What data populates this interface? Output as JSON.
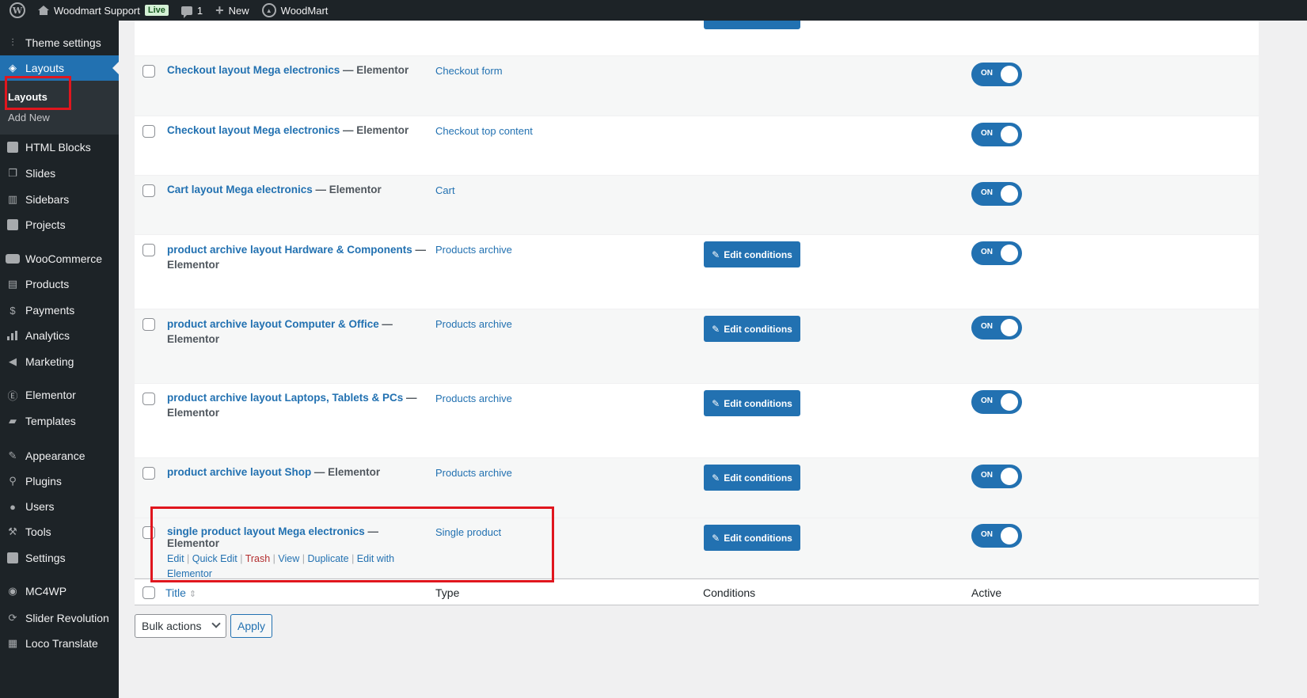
{
  "adminbar": {
    "site_name": "Woodmart Support",
    "live_badge": "Live",
    "comments_count": "1",
    "new_label": "New",
    "theme_label": "WoodMart"
  },
  "sidebar": {
    "items": [
      {
        "label": "Theme settings",
        "icon": "sliders-icon"
      },
      {
        "label": "Layouts",
        "icon": "layers-icon"
      },
      {
        "label": "HTML Blocks",
        "icon": "code-block-icon"
      },
      {
        "label": "Slides",
        "icon": "slides-icon"
      },
      {
        "label": "Sidebars",
        "icon": "sidebar-icon"
      },
      {
        "label": "Projects",
        "icon": "briefcase-icon"
      },
      {
        "label": "WooCommerce",
        "icon": "woo-icon"
      },
      {
        "label": "Products",
        "icon": "archive-icon"
      },
      {
        "label": "Payments",
        "icon": "dollar-icon"
      },
      {
        "label": "Analytics",
        "icon": "bar-chart-icon"
      },
      {
        "label": "Marketing",
        "icon": "megaphone-icon"
      },
      {
        "label": "Elementor",
        "icon": "elementor-icon"
      },
      {
        "label": "Templates",
        "icon": "folder-icon"
      },
      {
        "label": "Appearance",
        "icon": "brush-icon"
      },
      {
        "label": "Plugins",
        "icon": "plug-icon"
      },
      {
        "label": "Users",
        "icon": "user-icon"
      },
      {
        "label": "Tools",
        "icon": "wrench-icon"
      },
      {
        "label": "Settings",
        "icon": "settings-icon"
      },
      {
        "label": "MC4WP",
        "icon": "mc4wp-icon"
      },
      {
        "label": "Slider Revolution",
        "icon": "refresh-icon"
      },
      {
        "label": "Loco Translate",
        "icon": "translate-icon"
      }
    ],
    "submenu": {
      "layouts": "Layouts",
      "add_new": "Add New"
    }
  },
  "rows": [
    {
      "title": "Checkout layout Mega electronics",
      "suffix": "— Elementor",
      "type": "Checkout form",
      "edit_conditions": "",
      "active": "ON"
    },
    {
      "title": "Checkout layout Mega electronics",
      "suffix": "— Elementor",
      "type": "Checkout top content",
      "edit_conditions": "",
      "active": "ON"
    },
    {
      "title": "Cart layout Mega electronics",
      "suffix": "— Elementor",
      "type": "Cart",
      "edit_conditions": "",
      "active": "ON"
    },
    {
      "title": "product archive layout Hardware & Components",
      "suffix": "— Elementor",
      "type": "Products archive",
      "edit_conditions": "Edit conditions",
      "active": "ON"
    },
    {
      "title": "product archive layout Computer & Office",
      "suffix": "— Elementor",
      "type": "Products archive",
      "edit_conditions": "Edit conditions",
      "active": "ON"
    },
    {
      "title": "product archive layout Laptops, Tablets & PCs",
      "suffix": "— Elementor",
      "type": "Products archive",
      "edit_conditions": "Edit conditions",
      "active": "ON"
    },
    {
      "title": "product archive layout Shop",
      "suffix": "— Elementor",
      "type": "Products archive",
      "edit_conditions": "Edit conditions",
      "active": "ON"
    },
    {
      "title": "single product layout Mega electronics",
      "suffix": "— Elementor",
      "type": "Single product",
      "edit_conditions": "Edit conditions",
      "active": "ON"
    }
  ],
  "row_actions": {
    "edit": "Edit",
    "quick_edit": "Quick Edit",
    "trash": "Trash",
    "view": "View",
    "duplicate": "Duplicate",
    "edit_with_elementor": "Edit with Elementor"
  },
  "table_footer": {
    "title": "Title",
    "type": "Type",
    "conditions": "Conditions",
    "active": "Active"
  },
  "bulk": {
    "selected": "Bulk actions",
    "apply": "Apply"
  },
  "colors": {
    "accent": "#2271b1",
    "sidebar_bg": "#1d2327",
    "highlight": "#e0161e"
  }
}
